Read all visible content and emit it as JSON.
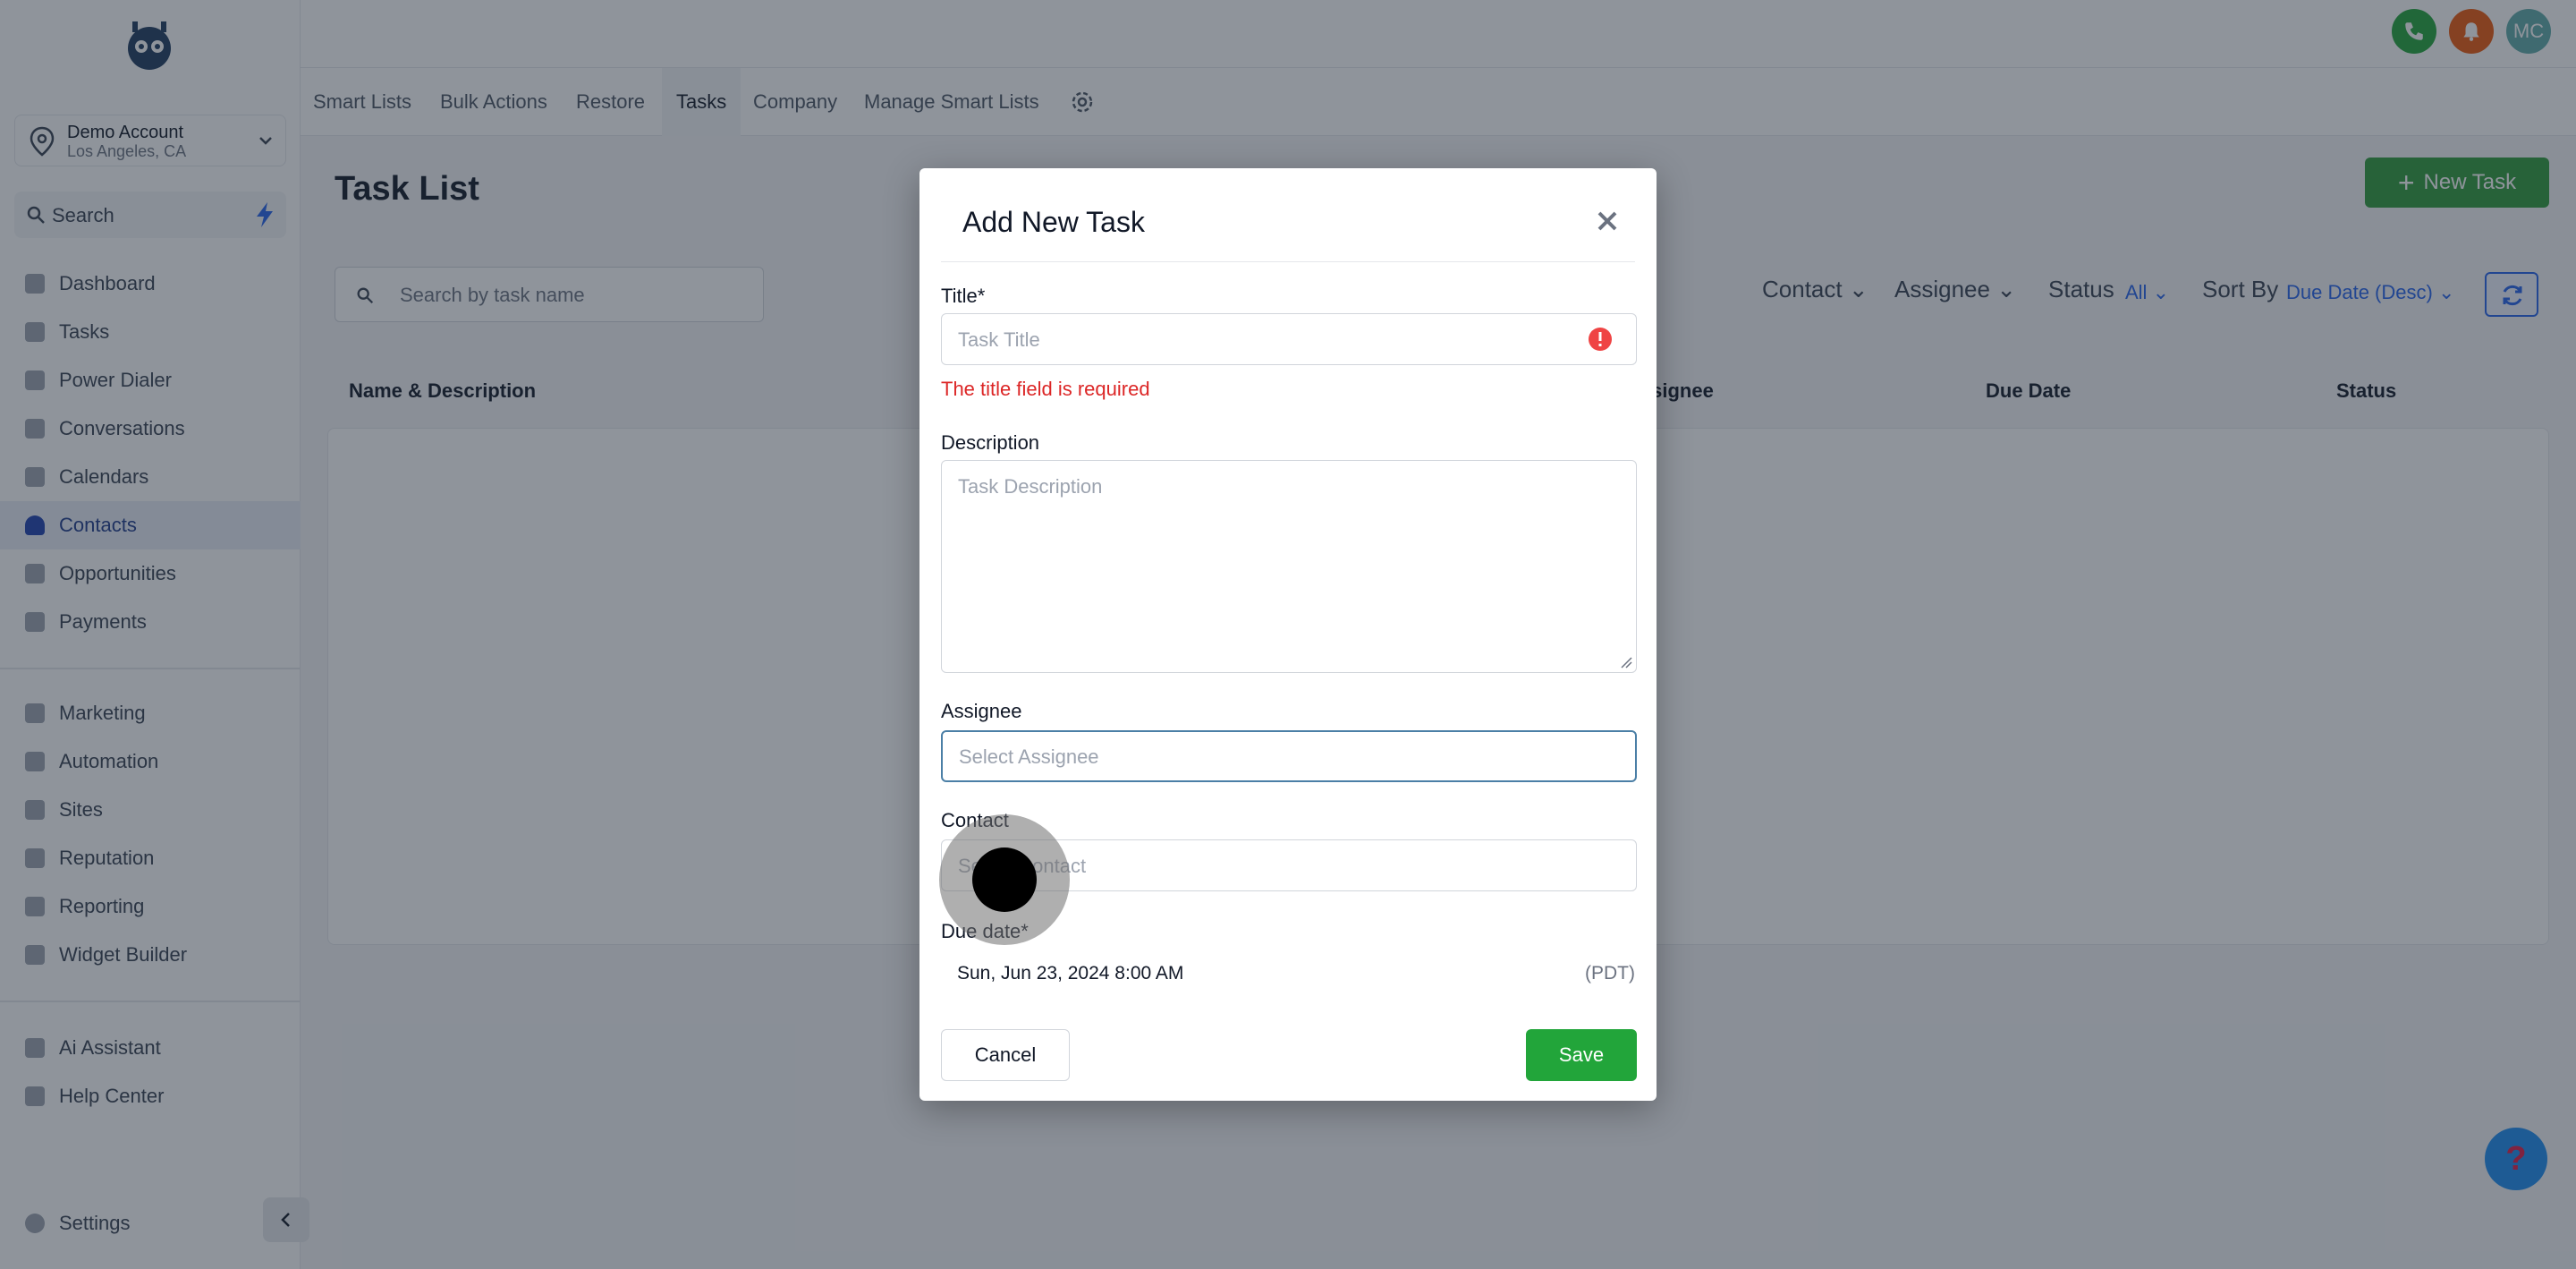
{
  "account": {
    "name": "Demo Account",
    "location": "Los Angeles, CA"
  },
  "search": {
    "label": "Search"
  },
  "sidebar": {
    "items": [
      {
        "label": "Dashboard"
      },
      {
        "label": "Tasks"
      },
      {
        "label": "Power Dialer"
      },
      {
        "label": "Conversations"
      },
      {
        "label": "Calendars"
      },
      {
        "label": "Contacts",
        "active": true
      },
      {
        "label": "Opportunities"
      },
      {
        "label": "Payments"
      }
    ],
    "items2": [
      {
        "label": "Marketing"
      },
      {
        "label": "Automation"
      },
      {
        "label": "Sites"
      },
      {
        "label": "Reputation"
      },
      {
        "label": "Reporting"
      },
      {
        "label": "Widget Builder"
      }
    ],
    "items3": [
      {
        "label": "Ai Assistant"
      },
      {
        "label": "Help Center"
      }
    ],
    "settings": "Settings"
  },
  "topbar": {
    "avatar_initials": "MC"
  },
  "tabs": [
    "Smart Lists",
    "Bulk Actions",
    "Restore",
    "Tasks",
    "Company",
    "Manage Smart Lists"
  ],
  "page": {
    "title": "Task List",
    "new_task_label": "New Task",
    "search_placeholder": "Search by task name",
    "filters": {
      "contact": "Contact",
      "assignee": "Assignee",
      "status": "Status",
      "status_value": "All",
      "sort_by": "Sort By",
      "sort_value": "Due Date (Desc)"
    },
    "columns": [
      "Name & Description",
      "Assignee",
      "Due Date",
      "Status"
    ]
  },
  "modal": {
    "title": "Add New Task",
    "title_label": "Title*",
    "title_placeholder": "Task Title",
    "title_error": "The title field is required",
    "description_label": "Description",
    "description_placeholder": "Task Description",
    "assignee_label": "Assignee",
    "assignee_placeholder": "Select Assignee",
    "contact_label": "Contact",
    "contact_placeholder": "Select Contact",
    "due_label": "Due date*",
    "due_value": "Sun, Jun 23, 2024 8:00 AM",
    "due_tz": "(PDT)",
    "cancel": "Cancel",
    "save": "Save"
  },
  "help": {
    "label": "?"
  },
  "colors": {
    "primary_green": "#2f9a3b",
    "save_green": "#22a53a",
    "error_red": "#dc2626",
    "accent_blue": "#2563eb"
  }
}
